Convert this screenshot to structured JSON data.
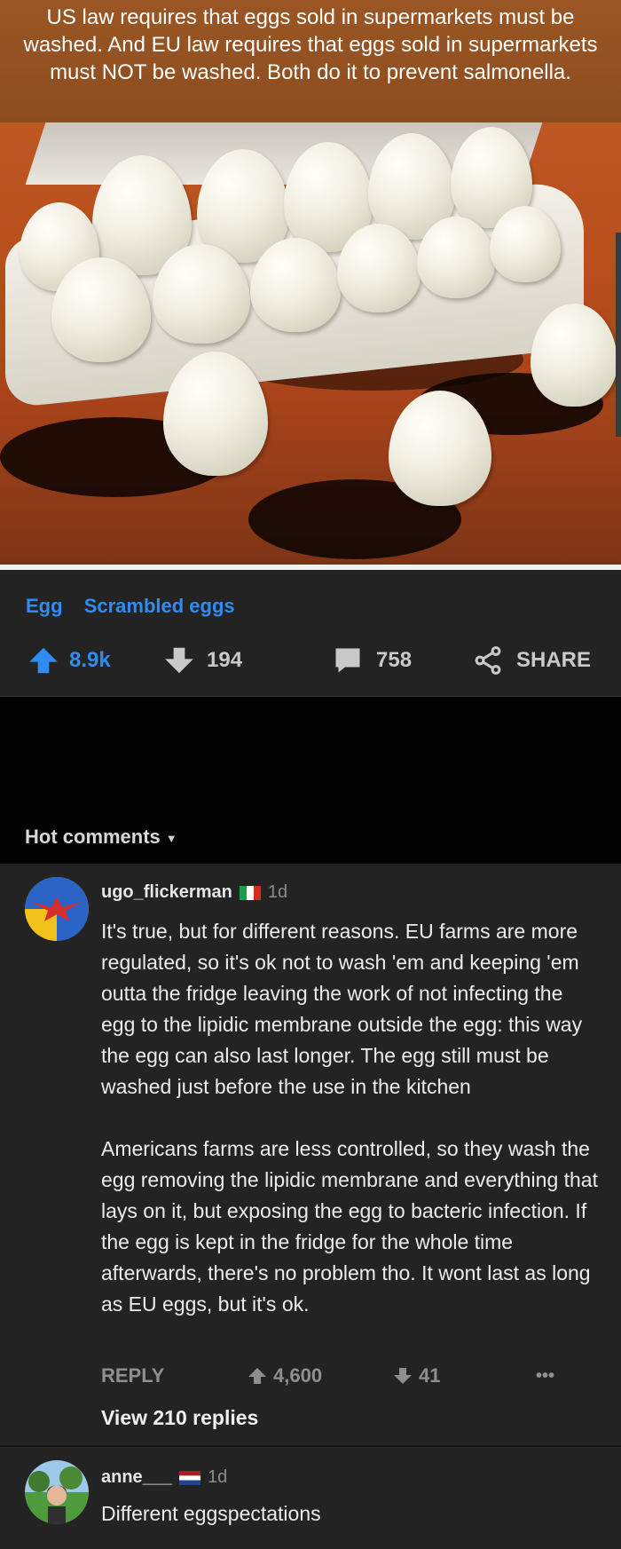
{
  "post": {
    "caption": "US law requires that eggs sold in supermarkets must be washed. And EU law requires that eggs sold in supermarkets must NOT be washed. Both do it to prevent salmonella.",
    "tags": [
      "Egg",
      "Scrambled eggs"
    ],
    "upvotes": "8.9k",
    "downvotes": "194",
    "comments": "758",
    "share_label": "SHARE"
  },
  "comments_header": {
    "label": "Hot comments"
  },
  "comment1": {
    "username": "ugo_flickerman",
    "flag": "italy-flag",
    "time": "1d",
    "body": "It's true, but for different reasons. EU farms are more regulated, so it's ok not to wash 'em and keeping 'em outta the fridge leaving the work of not infecting the egg to the lipidic membrane outside the egg: this way the egg can also last longer. The egg still must be washed just before the use in the kitchen\n\nAmericans farms are less controlled, so they wash the egg removing the lipidic membrane and everything that lays on it, but exposing the egg to bacteric infection. If the egg is kept in the fridge for the whole time afterwards, there's no problem tho. It wont last as long as EU eggs, but it's ok.",
    "reply_label": "REPLY",
    "upvotes": "4,600",
    "downvotes": "41",
    "more_label": "•••",
    "view_replies": "View 210 replies"
  },
  "comment2": {
    "username": "anne___",
    "flag": "netherlands-flag",
    "time": "1d",
    "body": "Different eggspectations"
  },
  "colors": {
    "accent_blue": "#2f8cf2",
    "background": "#232323",
    "band": "#010101"
  }
}
